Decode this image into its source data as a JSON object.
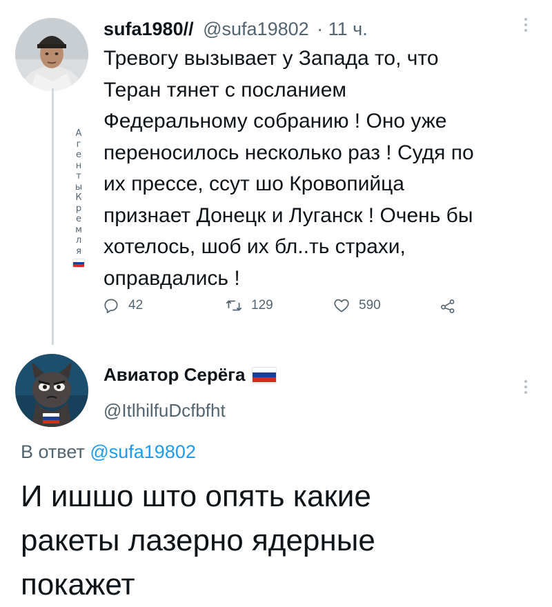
{
  "tweet1": {
    "display_name": "sufa1980//",
    "handle": "@sufa19802",
    "time": "· 11 ч.",
    "lines": [
      "Тревогу вызывает у Запада то, что",
      "Теран тянет с посланием",
      "Федеральному собранию ! Оно уже",
      "переносилось несколько раз ! Судя по",
      "их прессе, ссут шо Кровопийца",
      "признает Донецк и Луганск ! Очень бы",
      "хотелось, шоб их бл..ть страхи,",
      "оправдались !"
    ],
    "vertical_name_chars": [
      "А",
      "г",
      "е",
      "н",
      "т",
      "ы",
      "К",
      "р",
      "е",
      "м",
      "л",
      "я"
    ],
    "replies": "42",
    "retweets": "129",
    "likes": "590"
  },
  "tweet2": {
    "display_name": "Авиатор Серёга",
    "handle": "@ItlhilfuDcfbfht",
    "reply_prefix": "В ответ",
    "reply_handle": "@sufa19802",
    "lines": [
      "И ишшо што опять какие",
      "ракеты лазерно ядерные",
      "покажет"
    ]
  },
  "colors": {
    "text": "#0f1419",
    "muted": "#536471",
    "link": "#1d9bf0",
    "thread_line": "#cfd9de",
    "flag_white": "#ffffff",
    "flag_blue": "#1c3f94",
    "flag_red": "#d52b1e"
  },
  "icons": {
    "reply": "reply-icon",
    "retweet": "retweet-icon",
    "like": "heart-icon",
    "share": "share-icon",
    "more": "more-options-icon"
  }
}
